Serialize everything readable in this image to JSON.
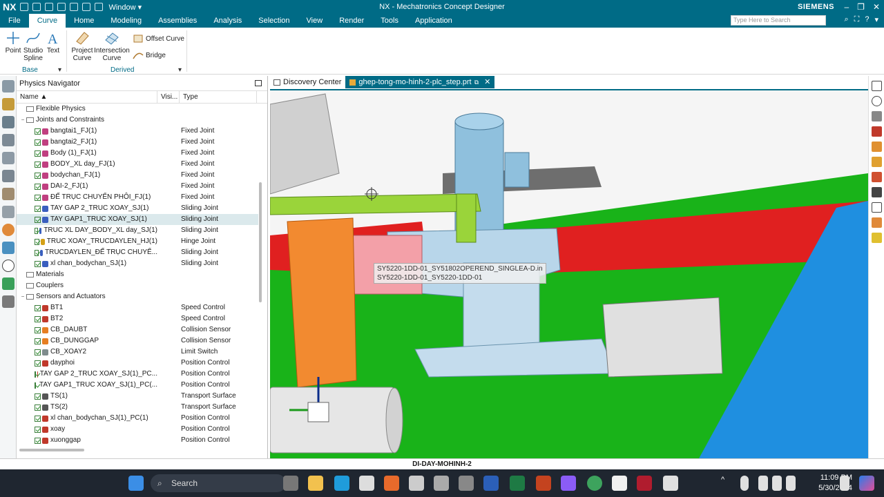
{
  "app": {
    "logo": "NX",
    "window_menu": "Window ▾",
    "title": "NX - Mechatronics Concept Designer",
    "brand": "SIEMENS"
  },
  "menu": {
    "tabs": [
      "File",
      "Curve",
      "Home",
      "Modeling",
      "Assemblies",
      "Analysis",
      "Selection",
      "View",
      "Render",
      "Tools",
      "Application"
    ],
    "active_tab": "Curve",
    "search_placeholder": "Type Here to Search"
  },
  "ribbon": {
    "point": "Point",
    "studio_spline": "Studio Spline",
    "text": "Text",
    "base_group": "Base",
    "project_curve": "Project Curve",
    "intersection_curve": "Intersection Curve",
    "offset_curve": "Offset Curve",
    "bridge": "Bridge",
    "derived_group": "Derived"
  },
  "navigator": {
    "title": "Physics Navigator",
    "col_name": "Name",
    "col_visi": "Visi...",
    "col_type": "Type",
    "rows": [
      {
        "level": 1,
        "kind": "folder",
        "tw": "",
        "name": "Flexible Physics",
        "type": ""
      },
      {
        "level": 1,
        "kind": "folder",
        "tw": "−",
        "name": "Joints and Constraints",
        "type": ""
      },
      {
        "level": 2,
        "kind": "item",
        "icon": "#c04080",
        "name": "bangtai1_FJ(1)",
        "type": "Fixed Joint"
      },
      {
        "level": 2,
        "kind": "item",
        "icon": "#c04080",
        "name": "bangtai2_FJ(1)",
        "type": "Fixed Joint"
      },
      {
        "level": 2,
        "kind": "item",
        "icon": "#c04080",
        "name": "Body (1)_FJ(1)",
        "type": "Fixed Joint"
      },
      {
        "level": 2,
        "kind": "item",
        "icon": "#c04080",
        "name": "BODY_XL day_FJ(1)",
        "type": "Fixed Joint"
      },
      {
        "level": 2,
        "kind": "item",
        "icon": "#c04080",
        "name": "bodychan_FJ(1)",
        "type": "Fixed Joint"
      },
      {
        "level": 2,
        "kind": "item",
        "icon": "#c04080",
        "name": "DAI-2_FJ(1)",
        "type": "Fixed Joint"
      },
      {
        "level": 2,
        "kind": "item",
        "icon": "#c04080",
        "name": "ĐẾ TRỤC CHUYỂN PHÔI_FJ(1)",
        "type": "Fixed Joint"
      },
      {
        "level": 2,
        "kind": "item",
        "icon": "#3a5fbf",
        "name": "TAY GAP 2_TRUC XOAY_SJ(1)",
        "type": "Sliding Joint"
      },
      {
        "level": 2,
        "kind": "item",
        "icon": "#3a5fbf",
        "name": "TAY GAP1_TRUC XOAY_SJ(1)",
        "type": "Sliding Joint",
        "selected": true
      },
      {
        "level": 2,
        "kind": "item",
        "icon": "#3a5fbf",
        "name": "TRUC XL DAY_BODY_XL day_SJ(1)",
        "type": "Sliding Joint"
      },
      {
        "level": 2,
        "kind": "item",
        "icon": "#d4a017",
        "name": "TRUC XOAY_TRUCDAYLEN_HJ(1)",
        "type": "Hinge Joint"
      },
      {
        "level": 2,
        "kind": "item",
        "icon": "#3a5fbf",
        "name": "TRUCDAYLEN_ĐẾ TRỤC CHUYỂ...",
        "type": "Sliding Joint"
      },
      {
        "level": 2,
        "kind": "item",
        "icon": "#3a5fbf",
        "name": "xl chan_bodychan_SJ(1)",
        "type": "Sliding Joint"
      },
      {
        "level": 1,
        "kind": "folder",
        "tw": "",
        "name": "Materials",
        "type": ""
      },
      {
        "level": 1,
        "kind": "folder",
        "tw": "",
        "name": "Couplers",
        "type": ""
      },
      {
        "level": 1,
        "kind": "folder",
        "tw": "−",
        "name": "Sensors and Actuators",
        "type": ""
      },
      {
        "level": 2,
        "kind": "item",
        "icon": "#c0392b",
        "name": "BT1",
        "type": "Speed Control"
      },
      {
        "level": 2,
        "kind": "item",
        "icon": "#c0392b",
        "name": "BT2",
        "type": "Speed Control"
      },
      {
        "level": 2,
        "kind": "item",
        "icon": "#e67e22",
        "name": "CB_DAUBT",
        "type": "Collision Sensor"
      },
      {
        "level": 2,
        "kind": "item",
        "icon": "#e67e22",
        "name": "CB_DUNGGAP",
        "type": "Collision Sensor"
      },
      {
        "level": 2,
        "kind": "item",
        "icon": "#7f8c8d",
        "name": "CB_XOAY2",
        "type": "Limit Switch"
      },
      {
        "level": 2,
        "kind": "item",
        "icon": "#c0392b",
        "name": "dayphoi",
        "type": "Position Control"
      },
      {
        "level": 2,
        "kind": "item",
        "icon": "#c0392b",
        "name": "TAY GAP 2_TRUC XOAY_SJ(1)_PC...",
        "type": "Position Control"
      },
      {
        "level": 2,
        "kind": "item",
        "icon": "#c0392b",
        "name": "TAY GAP1_TRUC XOAY_SJ(1)_PC(...",
        "type": "Position Control"
      },
      {
        "level": 2,
        "kind": "item",
        "icon": "#555555",
        "name": "TS(1)",
        "type": "Transport Surface"
      },
      {
        "level": 2,
        "kind": "item",
        "icon": "#555555",
        "name": "TS(2)",
        "type": "Transport Surface"
      },
      {
        "level": 2,
        "kind": "item",
        "icon": "#c0392b",
        "name": "xl chan_bodychan_SJ(1)_PC(1)",
        "type": "Position Control"
      },
      {
        "level": 2,
        "kind": "item",
        "icon": "#c0392b",
        "name": "xoay",
        "type": "Position Control"
      },
      {
        "level": 2,
        "kind": "item",
        "icon": "#c0392b",
        "name": "xuonggap",
        "type": "Position Control"
      }
    ]
  },
  "doc_tabs": {
    "discovery": "Discovery Center",
    "part": "ghep-tong-mo-hinh-2-plc_step.prt"
  },
  "viewport": {
    "tooltip_line1": "SY5220-1DD-01_SY51802OPEREND_SINGLEA-D.in",
    "tooltip_line2": "SY5220-1DD-01_SY5220-1DD-01"
  },
  "status": {
    "text": "DI-DAY-MOHINH-2"
  },
  "taskbar": {
    "search": "Search",
    "time": "11:09 PM",
    "date": "5/30/2024"
  },
  "colors": {
    "accent": "#006b86",
    "floor_green": "#19b319",
    "wall_red": "#e02020",
    "rail_blue": "#1f8fe0",
    "arm_green": "#9ad43a",
    "orange_body": "#f28a30"
  }
}
